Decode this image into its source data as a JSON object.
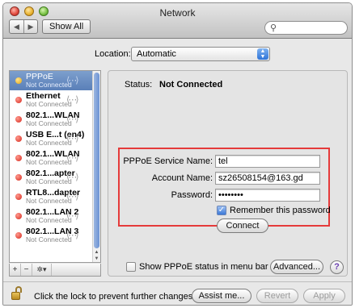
{
  "window": {
    "title": "Network"
  },
  "toolbar": {
    "back_label": "◀",
    "forward_label": "▶",
    "show_all_label": "Show All",
    "search_placeholder": ""
  },
  "location": {
    "label": "Location:",
    "value": "Automatic"
  },
  "sidebar": {
    "items": [
      {
        "name": "PPPoE",
        "status": "Not Connected",
        "dot": "yellow",
        "selected": true
      },
      {
        "name": "Ethernet",
        "status": "Not Connected",
        "dot": "red"
      },
      {
        "name": "802.1...WLAN",
        "status": "Not Connected",
        "dot": "red"
      },
      {
        "name": "USB E...t (en4)",
        "status": "Not Connected",
        "dot": "red"
      },
      {
        "name": "802.1...WLAN",
        "status": "Not Connected",
        "dot": "red"
      },
      {
        "name": "802.1...apter",
        "status": "Not Connected",
        "dot": "red"
      },
      {
        "name": "RTL8...dapter",
        "status": "Not Connected",
        "dot": "red"
      },
      {
        "name": "802.1...LAN 2",
        "status": "Not Connected",
        "dot": "red"
      },
      {
        "name": "802.1...LAN 3",
        "status": "Not Connected",
        "dot": "red"
      }
    ],
    "add_label": "+",
    "remove_label": "−",
    "action_label": "✲▾"
  },
  "detail": {
    "status_label": "Status:",
    "status_value": "Not Connected",
    "service_name_label": "PPPoE Service Name:",
    "service_name_value": "tel",
    "account_name_label": "Account Name:",
    "account_name_value": "sz26508154@163.gd",
    "password_label": "Password:",
    "password_value": "••••••••",
    "remember_label": "Remember this password",
    "remember_checked": true,
    "connect_label": "Connect",
    "show_status_label": "Show PPPoE status in menu bar",
    "advanced_label": "Advanced...",
    "help_label": "?"
  },
  "footer": {
    "lock_text": "Click the lock to prevent further changes.",
    "assist_label": "Assist me...",
    "revert_label": "Revert",
    "apply_label": "Apply"
  },
  "colors": {
    "highlight_box": "#e53a3a",
    "selection": "#6f92c6",
    "status_red": "#d6271c",
    "status_yellow": "#e2a514"
  }
}
